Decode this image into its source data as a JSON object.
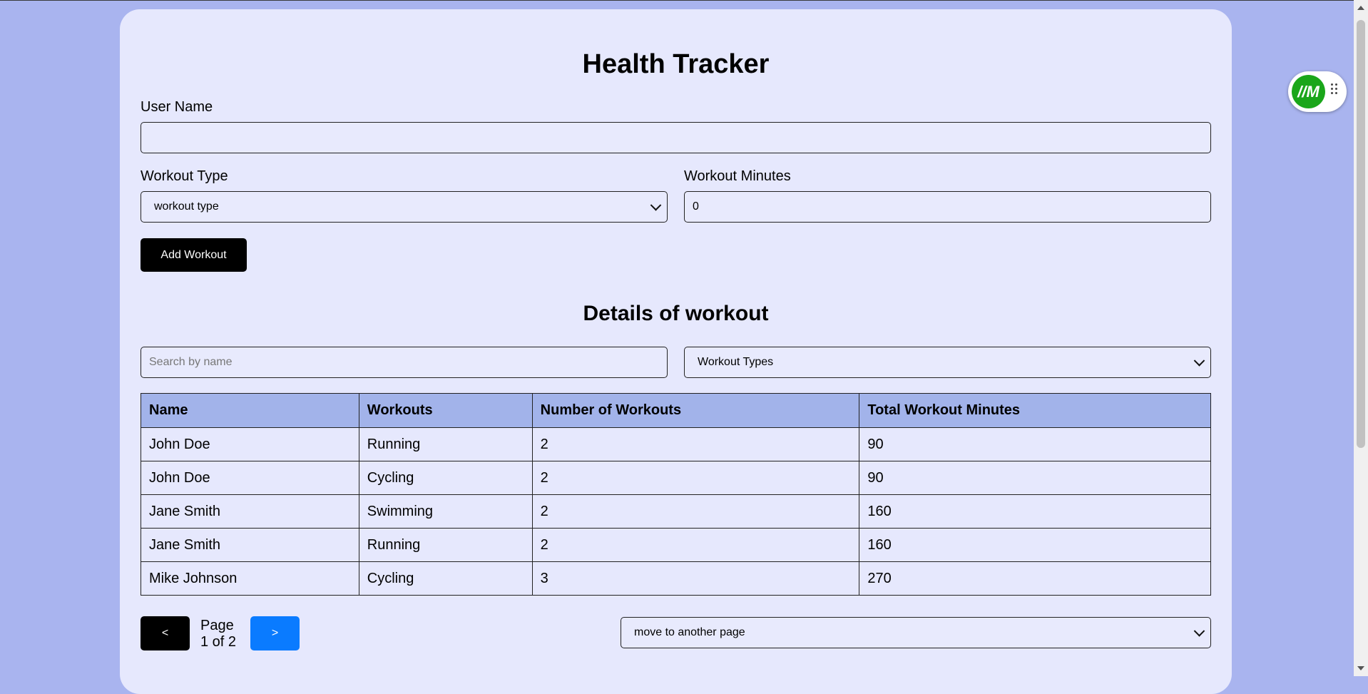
{
  "app": {
    "title": "Health Tracker"
  },
  "form": {
    "user_name_label": "User Name",
    "user_name_value": "",
    "workout_type_label": "Workout Type",
    "workout_type_selected": "workout type",
    "workout_minutes_label": "Workout Minutes",
    "workout_minutes_value": "0",
    "add_button_label": "Add Workout"
  },
  "details": {
    "title": "Details of workout",
    "search_placeholder": "Search by name",
    "filter_selected": "Workout Types"
  },
  "table": {
    "columns": [
      "Name",
      "Workouts",
      "Number of Workouts",
      "Total Workout Minutes"
    ],
    "rows": [
      [
        "John Doe",
        "Running",
        "2",
        "90"
      ],
      [
        "John Doe",
        "Cycling",
        "2",
        "90"
      ],
      [
        "Jane Smith",
        "Swimming",
        "2",
        "160"
      ],
      [
        "Jane Smith",
        "Running",
        "2",
        "160"
      ],
      [
        "Mike Johnson",
        "Cycling",
        "3",
        "270"
      ]
    ]
  },
  "pagination": {
    "prev_label": "<",
    "next_label": ">",
    "page_word": "Page",
    "page_status": "1 of 2",
    "move_select_selected": "move to another page"
  },
  "extension": {
    "logo_text": "//M",
    "icon": "drag-grip-icon"
  },
  "colors": {
    "page_bg": "#a9b4ef",
    "card_bg": "#e6e8fd",
    "table_header_bg": "#a2b3ea",
    "primary_dark": "#000000",
    "accent_blue": "#0a7bff",
    "extension_green": "#1aa61a"
  }
}
